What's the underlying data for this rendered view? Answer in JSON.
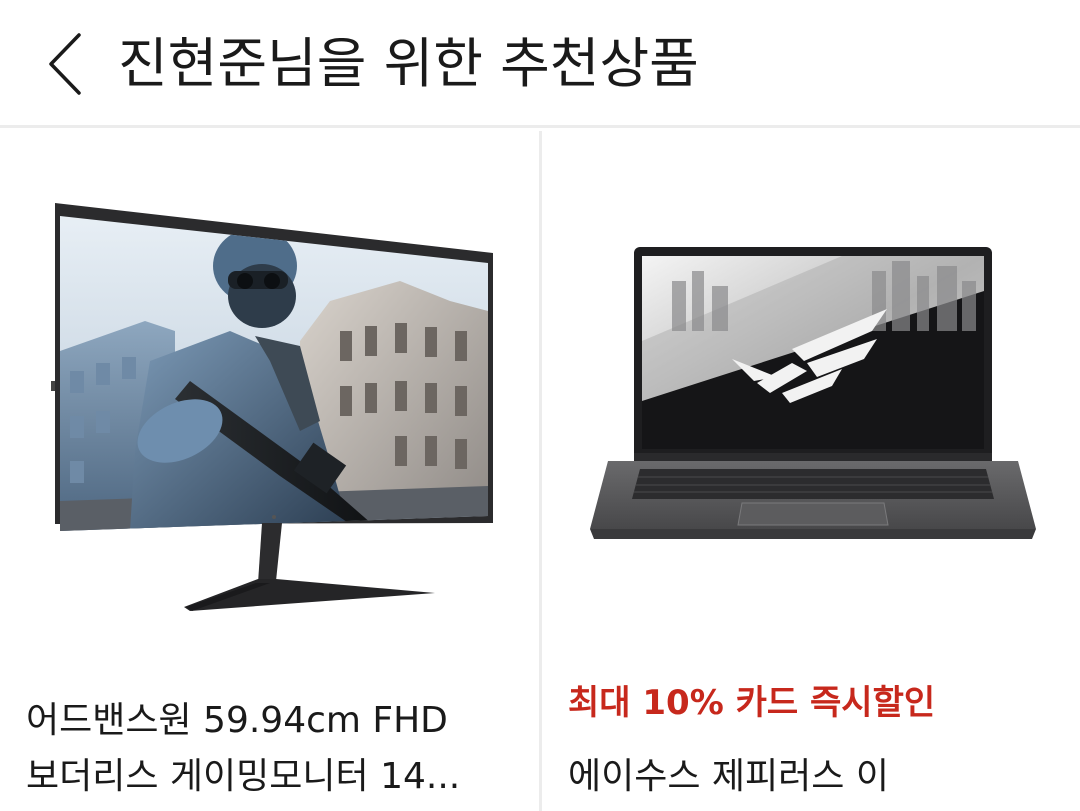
{
  "header": {
    "back_icon": "chevron-left-icon",
    "title": "진현준님을 위한 추천상품"
  },
  "products": [
    {
      "image": "gaming-monitor-image",
      "name_line1": "어드밴스원 59.94cm FHD",
      "name_line2": "보더리스 게이밍모니터 14..."
    },
    {
      "image": "gaming-laptop-image",
      "promo": "최대 10% 카드 즉시할인",
      "name": "에이수스 제피러스 이"
    }
  ],
  "colors": {
    "promo": "#c7281c",
    "divider": "#ececec",
    "text": "#1a1a1a"
  }
}
